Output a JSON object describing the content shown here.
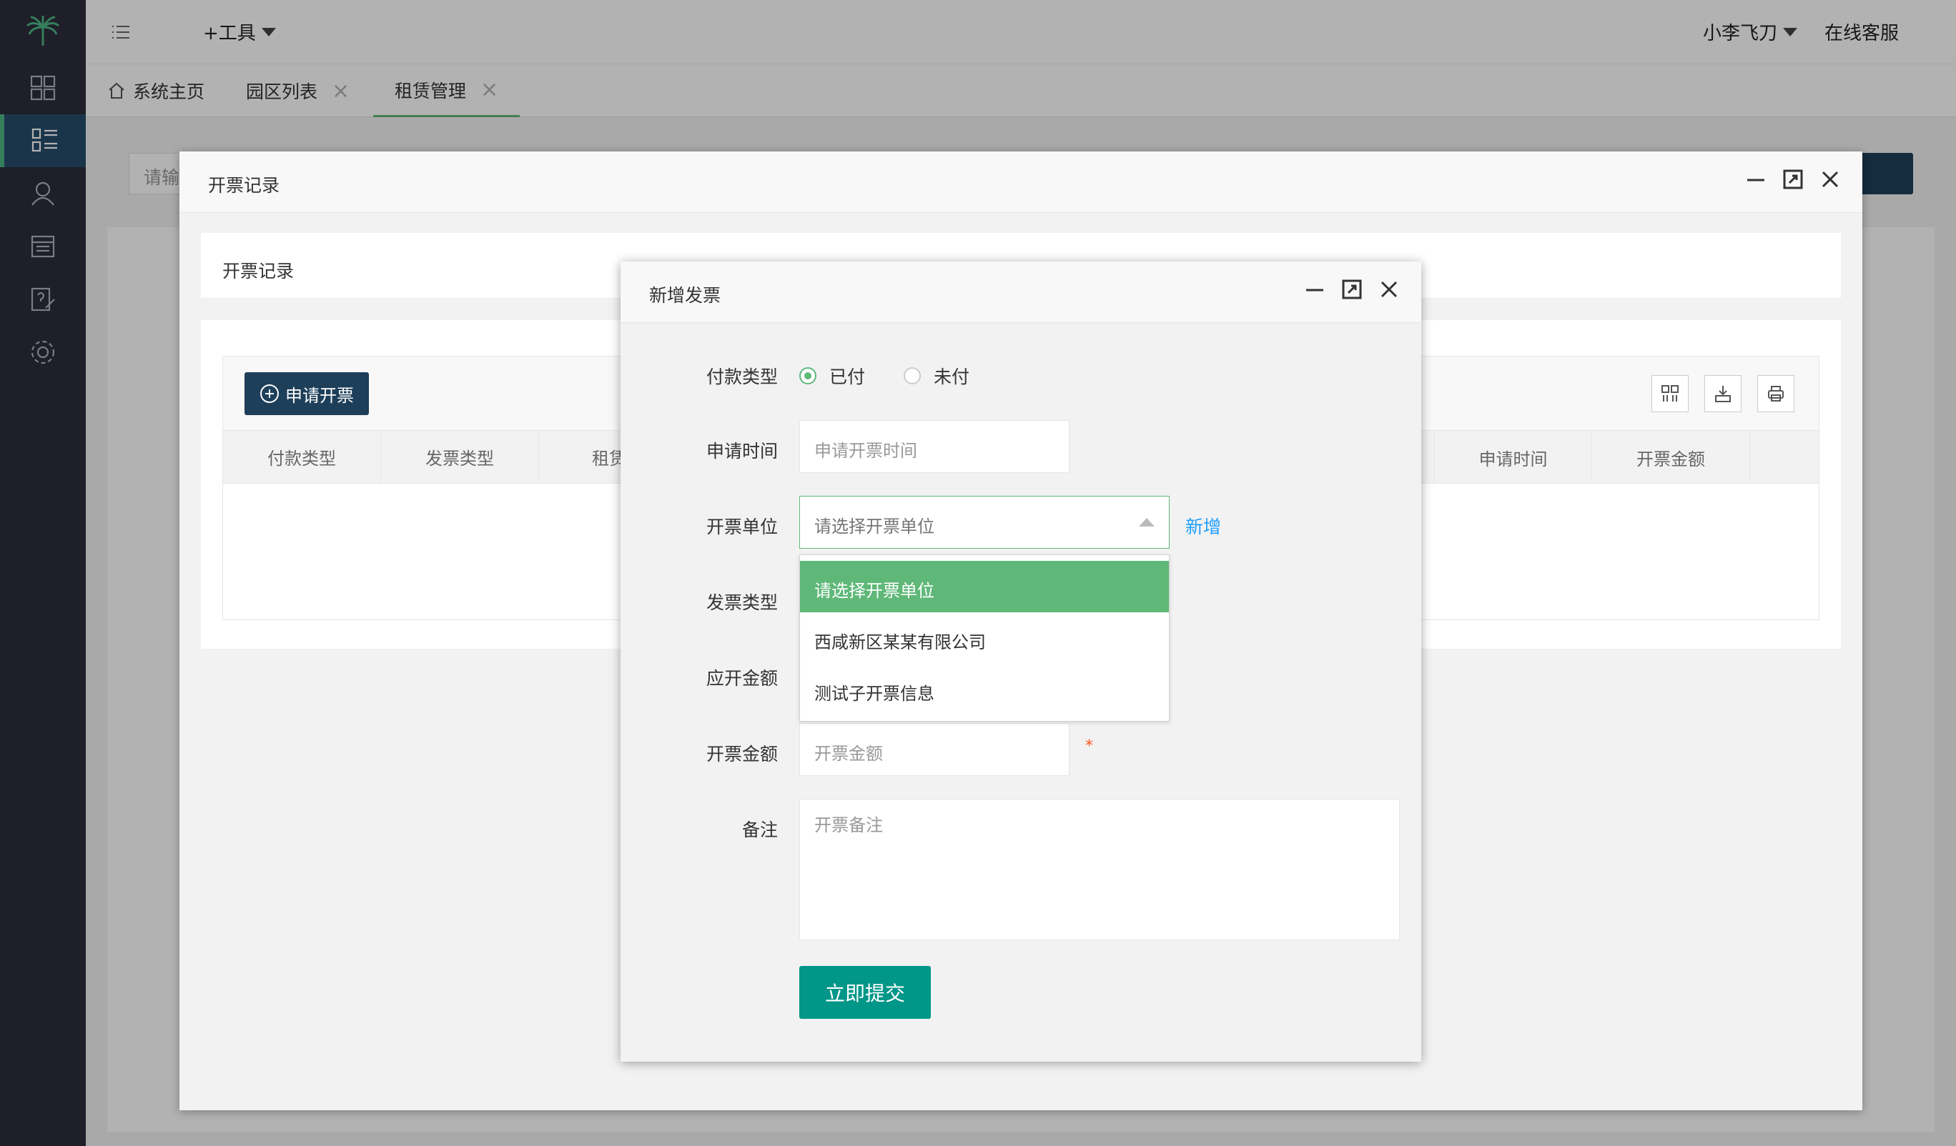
{
  "header": {
    "tools_label": "+工具",
    "user_label": "小李飞刀",
    "service_label": "在线客服"
  },
  "tabs": [
    {
      "label": "系统主页"
    },
    {
      "label": "园区列表"
    },
    {
      "label": "租赁管理"
    }
  ],
  "background": {
    "search_placeholder": "请输"
  },
  "outer_modal": {
    "title": "开票记录",
    "card_title": "开票记录",
    "apply_button": "申请开票",
    "columns_left": [
      "付款类型",
      "发票类型",
      "租赁方"
    ],
    "columns_right": [
      "申请时间",
      "开票金额"
    ]
  },
  "inner_modal": {
    "title": "新增发票",
    "payment_type_label": "付款类型",
    "payment_options": [
      "已付",
      "未付"
    ],
    "apply_time_label": "申请时间",
    "apply_time_placeholder": "申请开票时间",
    "unit_label": "开票单位",
    "unit_placeholder": "请选择开票单位",
    "add_link": "新增",
    "unit_options": [
      "请选择开票单位",
      "西咸新区某某有限公司",
      "测试子开票信息"
    ],
    "invoice_type_label": "发票类型",
    "due_amount_label": "应开金额",
    "amount_label": "开票金额",
    "amount_placeholder": "开票金额",
    "required_mark": "*",
    "remark_label": "备注",
    "remark_placeholder": "开票备注",
    "submit_label": "立即提交"
  },
  "colors": {
    "sidebar_bg": "#2b2d3a",
    "accent_green": "#5fb878",
    "submit_teal": "#009688",
    "dark_blue": "#1e3f5a"
  }
}
